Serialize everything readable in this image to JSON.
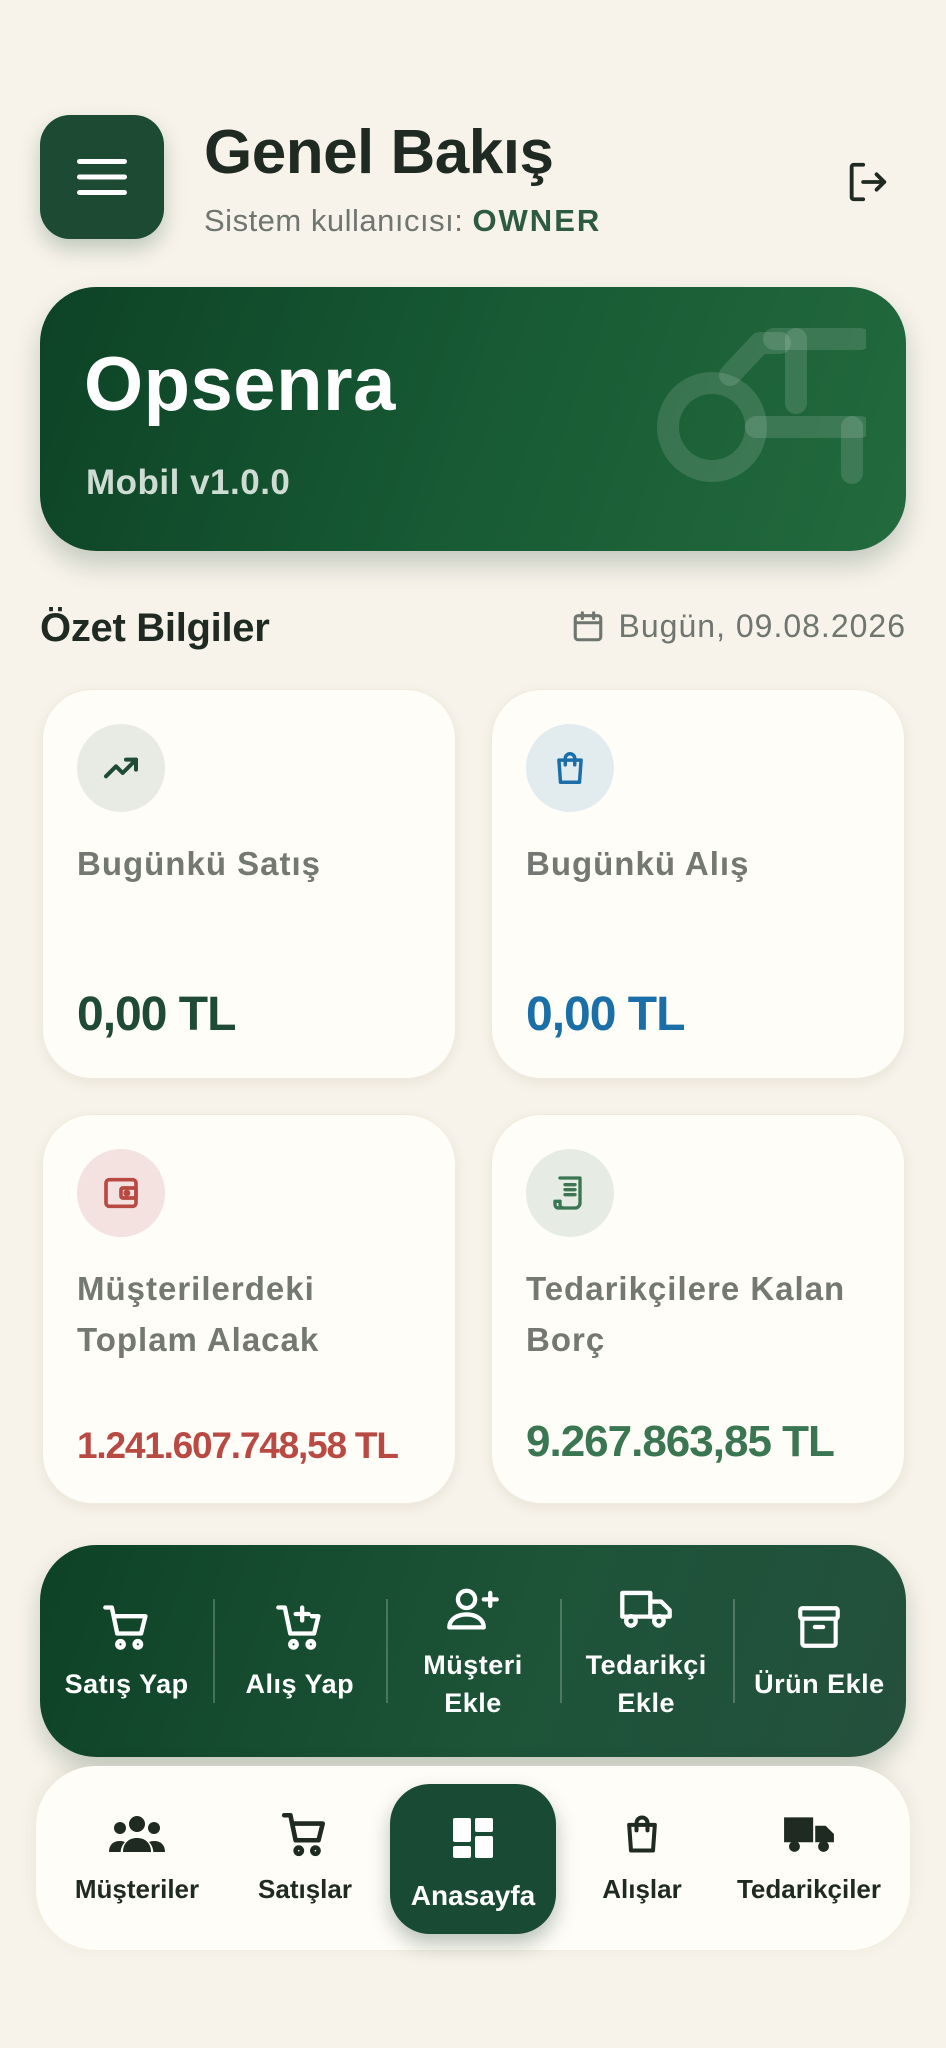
{
  "header": {
    "title": "Genel Bakış",
    "subtitle_prefix": "Sistem kullanıcısı:",
    "role": "OWNER"
  },
  "hero": {
    "title": "Opsenra",
    "version": "Mobil v1.0.0"
  },
  "summary": {
    "title": "Özet Bilgiler",
    "date": "Bugün, 09.08.2026"
  },
  "cards": [
    {
      "label": "Bugünkü Satış",
      "value": "0,00 TL",
      "color": "#1f4a35",
      "icon": "trending-up-icon"
    },
    {
      "label": "Bugünkü Alış",
      "value": "0,00 TL",
      "color": "#1b6fa8",
      "icon": "shopping-bag-icon"
    },
    {
      "label": "Müşterilerdeki Toplam Alacak",
      "value": "1.241.607.748,58 TL",
      "color": "#b84a43",
      "icon": "wallet-icon"
    },
    {
      "label": "Tedarikçilere Kalan Borç",
      "value": "9.267.863,85 TL",
      "color": "#3b7652",
      "icon": "receipt-icon"
    }
  ],
  "quick_actions": [
    {
      "label": "Satış Yap",
      "icon": "cart-icon"
    },
    {
      "label": "Alış Yap",
      "icon": "cart-plus-icon"
    },
    {
      "label": "Müşteri Ekle",
      "icon": "user-plus-icon"
    },
    {
      "label": "Tedarikçi Ekle",
      "icon": "truck-icon"
    },
    {
      "label": "Ürün Ekle",
      "icon": "archive-icon"
    }
  ],
  "nav": [
    {
      "label": "Müşteriler",
      "icon": "users-icon"
    },
    {
      "label": "Satışlar",
      "icon": "cart-icon"
    },
    {
      "label": "Anasayfa",
      "icon": "dashboard-icon",
      "active": true
    },
    {
      "label": "Alışlar",
      "icon": "shopping-bag-icon"
    },
    {
      "label": "Tedarikçiler",
      "icon": "truck-icon"
    }
  ]
}
